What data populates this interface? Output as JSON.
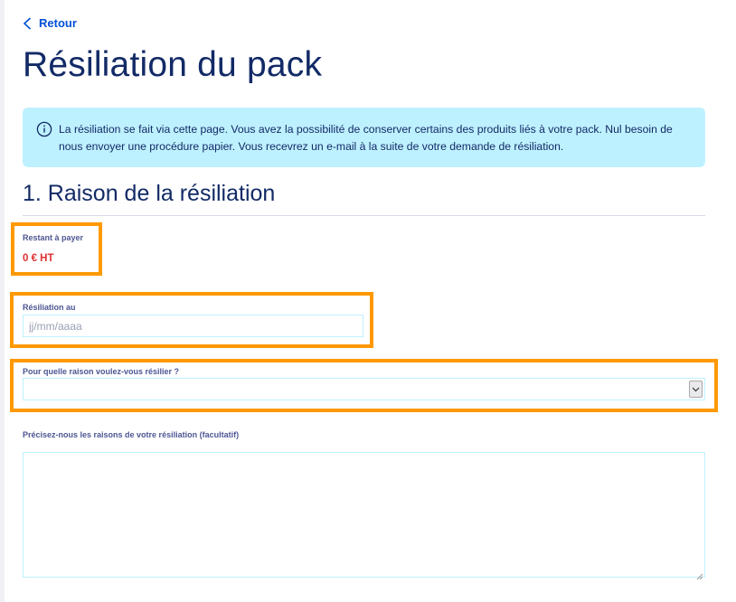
{
  "back_link": {
    "label": "Retour"
  },
  "page": {
    "title": "Résiliation du pack"
  },
  "info_banner": {
    "icon": "info-circle-icon",
    "text": "La résiliation se fait via cette page. Vous avez la possibilité de conserver certains des produits liés à votre pack. Nul besoin de nous envoyer une procédure papier. Vous recevrez un e-mail à la suite de votre demande de résiliation."
  },
  "section": {
    "title": "1. Raison de la résiliation"
  },
  "remaining": {
    "label": "Restant à payer",
    "value": "0 € HT"
  },
  "termination_date": {
    "label": "Résiliation au",
    "value": "",
    "placeholder": "jj/mm/aaaa"
  },
  "reason": {
    "label": "Pour quelle raison voulez-vous résilier ?",
    "selected": ""
  },
  "details": {
    "label": "Précisez-nous les raisons de votre résiliation (facultatif)",
    "value": ""
  },
  "colors": {
    "link": "#0050d7",
    "heading": "#122a66",
    "banner_bg": "#bef1ff",
    "amount": "#e03131",
    "highlight": "#ff9900"
  }
}
